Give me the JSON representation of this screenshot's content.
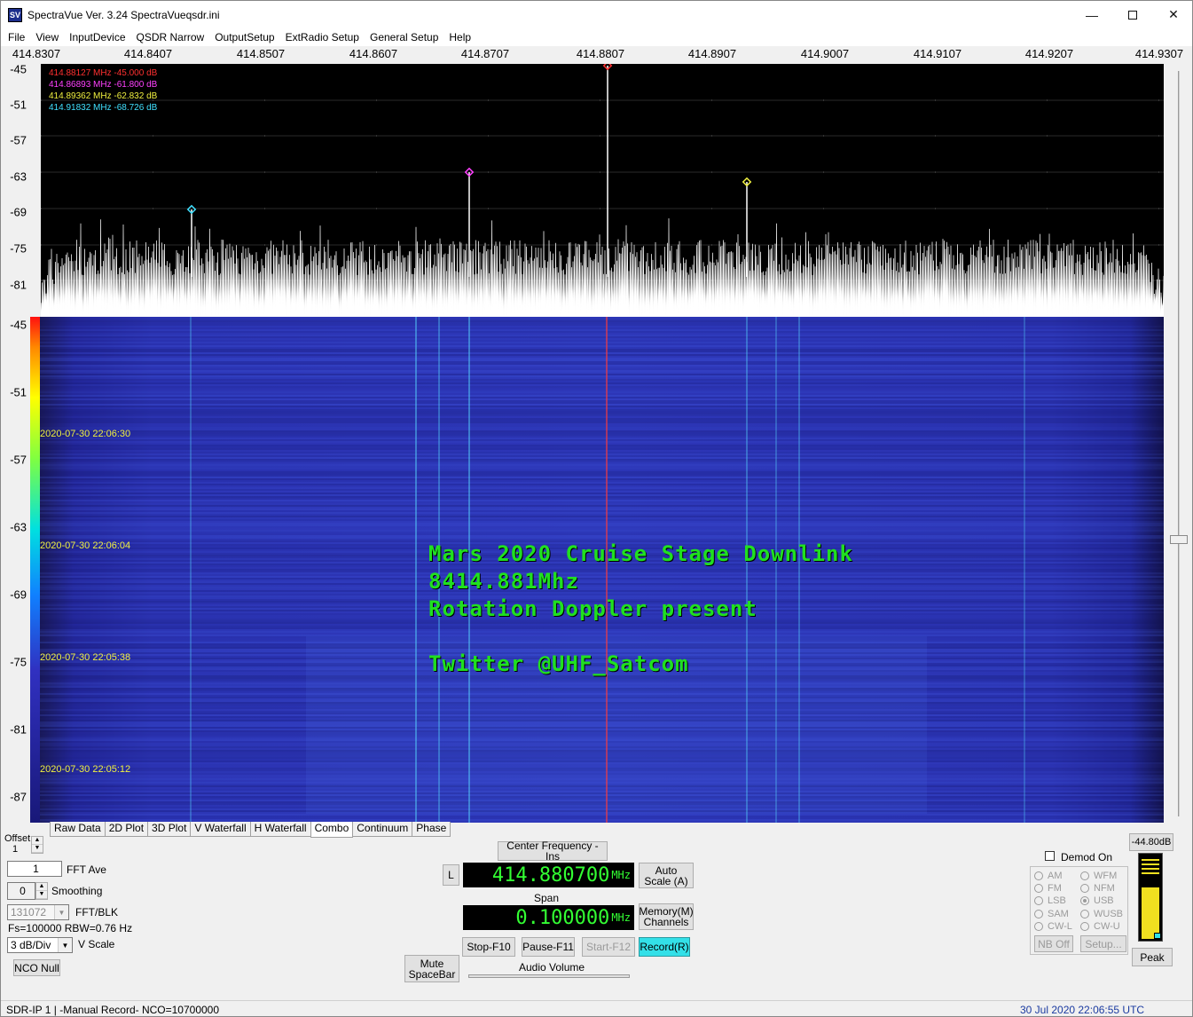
{
  "window": {
    "title": "SpectraVue Ver. 3.24  SpectraVueqsdr.ini",
    "icon_text": "SV"
  },
  "menu": [
    "File",
    "View",
    "InputDevice",
    "QSDR Narrow",
    "OutputSetup",
    "ExtRadio Setup",
    "General Setup",
    "Help"
  ],
  "freq_axis": [
    "414.8307",
    "414.8407",
    "414.8507",
    "414.8607",
    "414.8707",
    "414.8807",
    "414.8907",
    "414.9007",
    "414.9107",
    "414.9207",
    "414.9307"
  ],
  "spectrum_ylabels": [
    "-45",
    "-51",
    "-57",
    "-63",
    "-69",
    "-75",
    "-81"
  ],
  "markers": [
    {
      "text": "414.88127 MHz  -45.000 dB",
      "color": "#ff3030"
    },
    {
      "text": "414.86893 MHz  -61.800 dB",
      "color": "#ff40ff"
    },
    {
      "text": "414.89362 MHz  -62.832 dB",
      "color": "#f0f040"
    },
    {
      "text": "414.91832 MHz  -68.726 dB",
      "color": "#40e0ff"
    }
  ],
  "waterfall_ylabels": [
    "-45",
    "-51",
    "-57",
    "-63",
    "-69",
    "-75",
    "-81",
    "-87"
  ],
  "waterfall_timestamps": [
    "2020-07-30 22:06:30",
    "2020-07-30 22:06:04",
    "2020-07-30 22:05:38",
    "2020-07-30 22:05:12"
  ],
  "overlay": {
    "line1": "Mars 2020 Cruise Stage Downlink",
    "line2": "8414.881Mhz",
    "line3": "Rotation Doppler present",
    "line4": "Twitter @UHF_Satcom"
  },
  "tabs": [
    "Raw Data",
    "2D Plot",
    "3D Plot",
    "V Waterfall",
    "H Waterfall",
    "Combo",
    "Continuum",
    "Phase"
  ],
  "active_tab": "Combo",
  "controls": {
    "offset_label": "Offset",
    "offset_value": "1",
    "fft_ave_value": "1",
    "fft_ave_label": "FFT Ave",
    "smoothing_value": "0",
    "smoothing_label": "Smoothing",
    "fft_blk_value": "131072",
    "fft_blk_label": "FFT/BLK",
    "fs_text": "Fs=100000 RBW=0.76 Hz",
    "vscale_value": "3 dB/Div",
    "vscale_label": "V Scale",
    "nco_null": "NCO Null"
  },
  "center": {
    "center_freq_button": "Center Frequency - Ins",
    "l_button": "L",
    "freq_value": "414.880700",
    "freq_unit": "MHz",
    "auto_scale": "Auto Scale (A)",
    "span_label": "Span",
    "span_value": "0.100000",
    "span_unit": "MHz",
    "memory": "Memory(M) Channels",
    "stop": "Stop-F10",
    "pause": "Pause-F11",
    "start": "Start-F12",
    "record": "Record(R)",
    "mute": "Mute SpaceBar",
    "audio_volume": "Audio Volume"
  },
  "demod": {
    "label": "Demod On",
    "options": [
      {
        "name": "AM",
        "selected": false
      },
      {
        "name": "WFM",
        "selected": false
      },
      {
        "name": "FM",
        "selected": false
      },
      {
        "name": "NFM",
        "selected": false
      },
      {
        "name": "LSB",
        "selected": false
      },
      {
        "name": "USB",
        "selected": true
      },
      {
        "name": "SAM",
        "selected": false
      },
      {
        "name": "WUSB",
        "selected": false
      },
      {
        "name": "CW-L",
        "selected": false
      },
      {
        "name": "CW-U",
        "selected": false
      }
    ],
    "nb_off": "NB Off",
    "setup": "Setup..."
  },
  "meter": {
    "db_readout": "-44.80dB",
    "peak": "Peak",
    "level_fraction": 0.62
  },
  "status": {
    "left": "SDR-IP 1  | -Manual Record-   NCO=10700000",
    "right": "30 Jul 2020  22:06:55 UTC"
  },
  "colors": {
    "accent_record": "#33e0e8",
    "lcd_green": "#33ff33",
    "overlay_green": "#20e020"
  }
}
